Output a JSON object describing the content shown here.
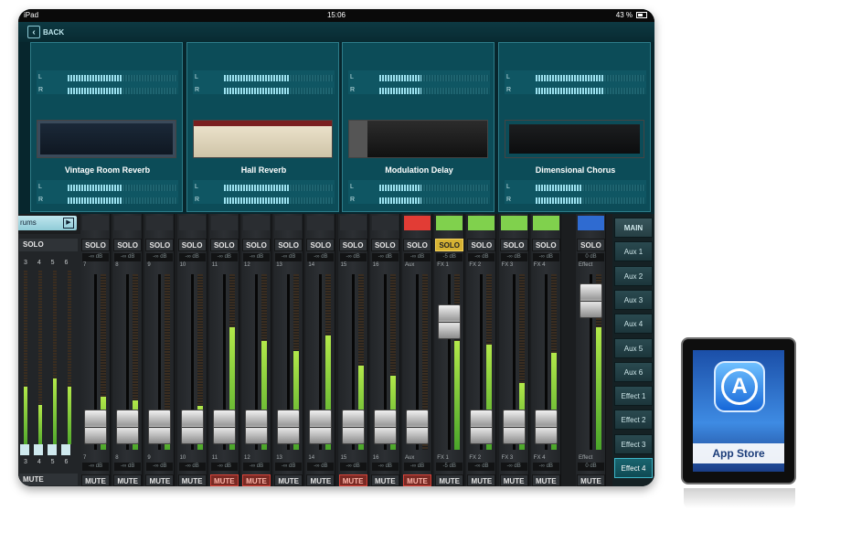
{
  "status_bar": {
    "carrier": "iPad",
    "time": "15:06",
    "battery": "43 %"
  },
  "topbar": {
    "back_label": "BACK"
  },
  "effects": [
    {
      "name": "Vintage Room Reverb",
      "in_l": 0.5,
      "in_r": 0.5,
      "out_l": 0.5,
      "out_r": 0.5
    },
    {
      "name": "Hall Reverb",
      "in_l": 0.6,
      "in_r": 0.6,
      "out_l": 0.6,
      "out_r": 0.6
    },
    {
      "name": "Modulation Delay",
      "in_l": 0.38,
      "in_r": 0.38,
      "out_l": 0.38,
      "out_r": 0.38
    },
    {
      "name": "Dimensional Chorus",
      "in_l": 0.62,
      "in_r": 0.62,
      "out_l": 0.42,
      "out_r": 0.42
    }
  ],
  "meter_labels": {
    "left": "L",
    "right": "R"
  },
  "mixer": {
    "layer_tab": "rums",
    "left_partial": {
      "solo": "SOLO",
      "mute": "MUTE",
      "channels": "3 4 5 6",
      "levels": [
        0.35,
        0.25,
        0.4,
        0.35
      ]
    },
    "solo_label": "SOLO",
    "mute_label": "MUTE",
    "channels": [
      {
        "num": "7",
        "db": "-∞ dB",
        "db2": "-∞ dB",
        "color": "#2a2d31",
        "solo_active": false,
        "mute_active": false,
        "fader": 0.13,
        "level": 0.3
      },
      {
        "num": "8",
        "db": "-∞ dB",
        "db2": "-∞ dB",
        "color": "#2a2d31",
        "solo_active": false,
        "mute_active": false,
        "fader": 0.13,
        "level": 0.28
      },
      {
        "num": "9",
        "db": "-∞ dB",
        "db2": "-∞ dB",
        "color": "#2a2d31",
        "solo_active": false,
        "mute_active": false,
        "fader": 0.13,
        "level": 0.18
      },
      {
        "num": "10",
        "db": "-∞ dB",
        "db2": "-∞ dB",
        "color": "#2a2d31",
        "solo_active": false,
        "mute_active": false,
        "fader": 0.13,
        "level": 0.25
      },
      {
        "num": "11",
        "db": "-∞ dB",
        "db2": "-∞ dB",
        "color": "#2a2d31",
        "solo_active": false,
        "mute_active": true,
        "fader": 0.13,
        "level": 0.7
      },
      {
        "num": "12",
        "db": "-∞ dB",
        "db2": "-∞ dB",
        "color": "#2a2d31",
        "solo_active": false,
        "mute_active": true,
        "fader": 0.13,
        "level": 0.62
      },
      {
        "num": "13",
        "db": "-∞ dB",
        "db2": "-∞ dB",
        "color": "#2a2d31",
        "solo_active": false,
        "mute_active": false,
        "fader": 0.13,
        "level": 0.56
      },
      {
        "num": "14",
        "db": "-∞ dB",
        "db2": "-∞ dB",
        "color": "#2a2d31",
        "solo_active": false,
        "mute_active": false,
        "fader": 0.13,
        "level": 0.65
      },
      {
        "num": "15",
        "db": "-∞ dB",
        "db2": "-∞ dB",
        "color": "#2a2d31",
        "solo_active": false,
        "mute_active": true,
        "fader": 0.13,
        "level": 0.48
      },
      {
        "num": "16",
        "db": "-∞ dB",
        "db2": "-∞ dB",
        "color": "#2a2d31",
        "solo_active": false,
        "mute_active": false,
        "fader": 0.13,
        "level": 0.42
      },
      {
        "num": "Aux",
        "db": "-∞ dB",
        "db2": "-∞ dB",
        "color": "#e23c35",
        "solo_active": false,
        "mute_active": true,
        "fader": 0.13,
        "level": 0.0
      },
      {
        "num": "FX 1",
        "db": "-5 dB",
        "db2": "-5 dB",
        "color": "#80d14d",
        "solo_active": true,
        "mute_active": false,
        "fader": 0.73,
        "level": 0.62
      },
      {
        "num": "FX 2",
        "db": "-∞ dB",
        "db2": "-∞ dB",
        "color": "#80d14d",
        "solo_active": false,
        "mute_active": false,
        "fader": 0.13,
        "level": 0.6
      },
      {
        "num": "FX 3",
        "db": "-∞ dB",
        "db2": "-∞ dB",
        "color": "#80d14d",
        "solo_active": false,
        "mute_active": false,
        "fader": 0.13,
        "level": 0.38
      },
      {
        "num": "FX 4",
        "db": "-∞ dB",
        "db2": "-∞ dB",
        "color": "#80d14d",
        "solo_active": false,
        "mute_active": false,
        "fader": 0.13,
        "level": 0.55
      }
    ],
    "effect_return": {
      "num": "Effect",
      "db": "0 dB",
      "db2": "0 dB",
      "color": "#2f6bd1",
      "solo_active": false,
      "mute_active": false,
      "fader": 0.85,
      "level": 0.7
    },
    "busses": [
      "MAIN",
      "Aux 1",
      "Aux 2",
      "Aux 3",
      "Aux 4",
      "Aux 5",
      "Aux 6",
      "Effect 1",
      "Effect 2",
      "Effect 3",
      "Effect 4"
    ],
    "active_bus": "Effect 4"
  },
  "app_store": {
    "label": "App Store",
    "icon": "app-store-icon"
  }
}
